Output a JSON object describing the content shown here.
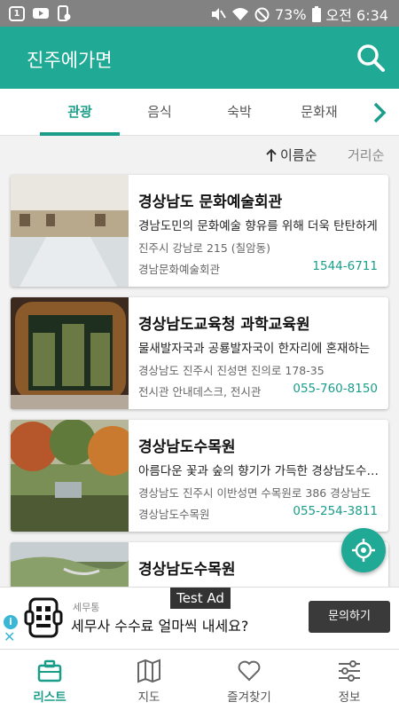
{
  "status_bar": {
    "notif_badge": "1",
    "battery": "73%",
    "time": "오전 6:34"
  },
  "app": {
    "title": "진주에가면"
  },
  "tabs": [
    {
      "label": "관광",
      "active": true
    },
    {
      "label": "음식",
      "active": false
    },
    {
      "label": "숙박",
      "active": false
    },
    {
      "label": "문화재",
      "active": false
    }
  ],
  "sort": {
    "name_label": "이름순",
    "distance_label": "거리순"
  },
  "places": [
    {
      "title": "경상남도 문화예술회관",
      "desc": "경남도민의 문화예술 향유를 위해 더욱 탄탄하게",
      "addr": "진주시 강남로 215 (칠암동)",
      "sub": "경남문화예술회관",
      "phone": "1544-6711"
    },
    {
      "title": "경상남도교육청 과학교육원",
      "desc": "물새발자국과 공룡발자국이 한자리에 혼재하는",
      "addr": "경상남도 진주시 진성면 진의로 178-35",
      "sub": "전시관 안내데스크, 전시관",
      "phone": "055-760-8150"
    },
    {
      "title": "경상남도수목원",
      "desc": "아름다운 꽃과 숲의 향기가 가득한 경상남도수목원",
      "addr": "경상남도 진주시 이반성면 수목원로 386 경상남도",
      "sub": "경상남도수목원",
      "phone": "055-254-3811"
    },
    {
      "title": "경상남도수목원",
      "desc": "",
      "addr": "",
      "sub": "",
      "phone": ""
    }
  ],
  "ad": {
    "test_label": "Test Ad",
    "info_icon": "i",
    "close_icon": "✕",
    "brand": "세무통",
    "text": "세무사 수수료 얼마씩 내세요?",
    "cta": "문의하기"
  },
  "bottom_nav": [
    {
      "label": "리스트",
      "icon": "briefcase-icon",
      "active": true
    },
    {
      "label": "지도",
      "icon": "map-icon",
      "active": false
    },
    {
      "label": "즐겨찾기",
      "icon": "heart-icon",
      "active": false
    },
    {
      "label": "정보",
      "icon": "sliders-icon",
      "active": false
    }
  ],
  "colors": {
    "primary": "#20aa96",
    "accent_text": "#1a9d89",
    "status_bar": "#828282"
  }
}
